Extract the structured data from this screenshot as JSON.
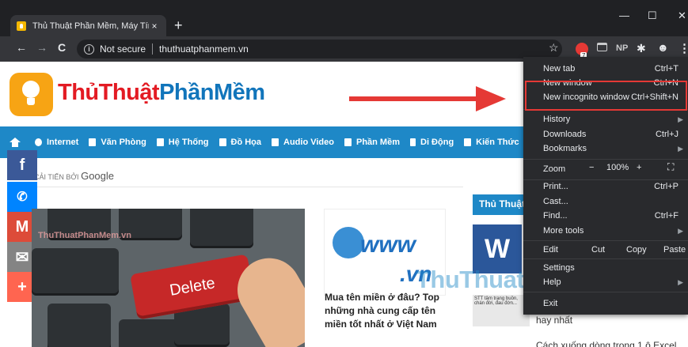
{
  "browser": {
    "tab_title": "Thủ Thuật Phần Mềm, Máy Tính,...",
    "tab_close": "×",
    "new_tab": "+",
    "win_min": "—",
    "win_max": "☐",
    "win_close": "✕",
    "nav_back": "←",
    "nav_forward": "→",
    "nav_reload": "C",
    "security_label": "Not secure",
    "url": "thuthuatphanmem.vn",
    "ext_badge": "7",
    "ext_np": "NP",
    "star": "☆",
    "menu_dots": "⋮"
  },
  "site": {
    "logo_part1": "Thủ",
    "logo_part2": "Thuật",
    "logo_part3": "Phần",
    "logo_part4": "Mềm",
    "nav": [
      {
        "label": "Internet"
      },
      {
        "label": "Văn Phòng"
      },
      {
        "label": "Hệ Thống"
      },
      {
        "label": "Đồ Họa"
      },
      {
        "label": "Audio Video"
      },
      {
        "label": "Phần Mềm"
      },
      {
        "label": "Di Động"
      },
      {
        "label": "Kiến Thức"
      }
    ],
    "google_prefix": "CẢI TIẾN BỞI",
    "google_brand": "Google",
    "social": {
      "facebook": "f",
      "messenger": "✆",
      "gmail": "M",
      "mail": "✉",
      "plus": "+"
    },
    "feature_watermark": "ThuThuatPhanMem.vn",
    "delete_key": "Delete",
    "card_title": "Mua tên miền ở đâu? Top những nhà cung cấp tên miền tốt nhất ở Việt Nam",
    "card_www": "www",
    "card_vn": ".vn",
    "section_tag": "Thủ Thuật",
    "word_letter": "W",
    "thumb2_text": "STT tâm trạng buồn, chán đời, đau đớn...",
    "side_text": "hay nhất",
    "side_text2": "Cách xuống dòng trong 1 ô Excel",
    "watermark": "ThuThuatPhanMem.vn"
  },
  "menu": {
    "new_tab": {
      "label": "New tab",
      "shortcut": "Ctrl+T"
    },
    "new_window": {
      "label": "New window",
      "shortcut": "Ctrl+N"
    },
    "new_incognito": {
      "label": "New incognito window",
      "shortcut": "Ctrl+Shift+N"
    },
    "history": {
      "label": "History"
    },
    "downloads": {
      "label": "Downloads",
      "shortcut": "Ctrl+J"
    },
    "bookmarks": {
      "label": "Bookmarks"
    },
    "zoom": {
      "label": "Zoom",
      "minus": "−",
      "value": "100%",
      "plus": "+",
      "fullscreen": "⛶"
    },
    "print": {
      "label": "Print...",
      "shortcut": "Ctrl+P"
    },
    "cast": {
      "label": "Cast..."
    },
    "find": {
      "label": "Find...",
      "shortcut": "Ctrl+F"
    },
    "more_tools": {
      "label": "More tools"
    },
    "edit": {
      "label": "Edit",
      "cut": "Cut",
      "copy": "Copy",
      "paste": "Paste"
    },
    "settings": {
      "label": "Settings"
    },
    "help": {
      "label": "Help"
    },
    "exit": {
      "label": "Exit"
    }
  }
}
